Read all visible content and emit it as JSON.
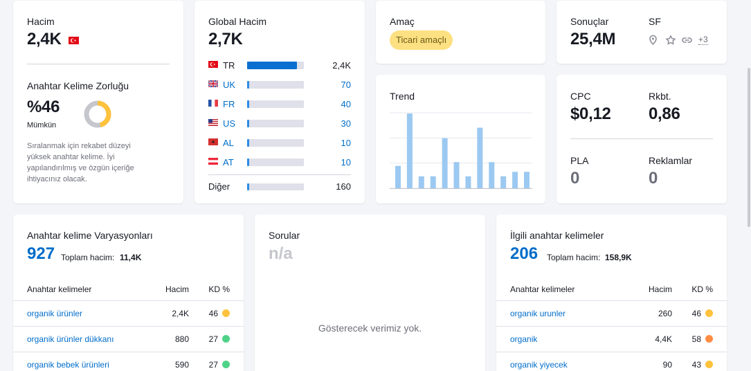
{
  "volume": {
    "label": "Hacim",
    "value": "2,4K",
    "flag_icon": "flag-tr-icon"
  },
  "kd": {
    "label": "Anahtar Kelime Zorluğu",
    "value": "%46",
    "level": "Mümkün",
    "percent": 46,
    "color": "#ffc23d",
    "description_lines": [
      "Sıralanmak için rekabet düzeyi",
      "yüksek anahtar kelime. İyi",
      "yapılandırılmış ve özgün içeriğe",
      "ihtiyacınız olacak."
    ]
  },
  "global_volume": {
    "label": "Global Hacim",
    "value": "2,7K",
    "countries": [
      {
        "code": "TR",
        "value": "2,4K",
        "fraction": 0.88,
        "flag_icon": "flag-tr-icon",
        "highlight": false
      },
      {
        "code": "UK",
        "value": "70",
        "fraction": 0.03,
        "flag_icon": "flag-uk-icon",
        "highlight": true
      },
      {
        "code": "FR",
        "value": "40",
        "fraction": 0.02,
        "flag_icon": "flag-fr-icon",
        "highlight": true
      },
      {
        "code": "US",
        "value": "30",
        "fraction": 0.02,
        "flag_icon": "flag-us-icon",
        "highlight": true
      },
      {
        "code": "AL",
        "value": "10",
        "fraction": 0.01,
        "flag_icon": "flag-al-icon",
        "highlight": true
      },
      {
        "code": "AT",
        "value": "10",
        "fraction": 0.01,
        "flag_icon": "flag-at-icon",
        "highlight": true
      }
    ],
    "other_label": "Diğer",
    "other_value": "160",
    "other_fraction": 0.03
  },
  "intent": {
    "label": "Amaç",
    "badge": "Ticari amaçlı",
    "badge_color": "#fce081"
  },
  "trend": {
    "label": "Trend",
    "values": [
      0.3,
      1.0,
      0.16,
      0.16,
      0.67,
      0.35,
      0.16,
      0.81,
      0.35,
      0.16,
      0.22,
      0.22
    ],
    "bar_color": "#9cc9f1"
  },
  "results": {
    "label": "Sonuçlar",
    "value": "25,4M",
    "sf_label": "SF",
    "sf_icons": [
      "location-pin-icon",
      "star-icon",
      "link-icon"
    ],
    "sf_more": "+3"
  },
  "cpc": {
    "label": "CPC",
    "value": "$0,12"
  },
  "competition": {
    "label": "Rkbt.",
    "value": "0,86"
  },
  "pla": {
    "label": "PLA",
    "value": "0"
  },
  "ads": {
    "label": "Reklamlar",
    "value": "0"
  },
  "variations": {
    "title": "Anahtar kelime Varyasyonları",
    "count": "927",
    "total_label": "Toplam hacim:",
    "total_value": "11,4K",
    "headers": {
      "keyword": "Anahtar kelimeler",
      "volume": "Hacim",
      "kd": "KD %"
    },
    "rows": [
      {
        "keyword": "organik ürünler",
        "volume": "2,4K",
        "kd": "46",
        "kd_color": "#ffc23d"
      },
      {
        "keyword": "organik ürünler dükkanı",
        "volume": "880",
        "kd": "27",
        "kd_color": "#4ed287"
      },
      {
        "keyword": "organik bebek ürünleri",
        "volume": "590",
        "kd": "27",
        "kd_color": "#4ed287"
      }
    ]
  },
  "questions": {
    "title": "Sorular",
    "value": "n/a",
    "empty_text": "Gösterecek verimiz yok."
  },
  "related": {
    "title": "İlgili anahtar kelimeler",
    "count": "206",
    "total_label": "Toplam hacim:",
    "total_value": "158,9K",
    "headers": {
      "keyword": "Anahtar kelimeler",
      "volume": "Hacim",
      "kd": "KD %"
    },
    "rows": [
      {
        "keyword": "organik urunler",
        "volume": "260",
        "kd": "46",
        "kd_color": "#ffc23d"
      },
      {
        "keyword": "organik",
        "volume": "4,4K",
        "kd": "58",
        "kd_color": "#ff8c43"
      },
      {
        "keyword": "organik yiyecek",
        "volume": "90",
        "kd": "43",
        "kd_color": "#ffc23d"
      }
    ]
  }
}
